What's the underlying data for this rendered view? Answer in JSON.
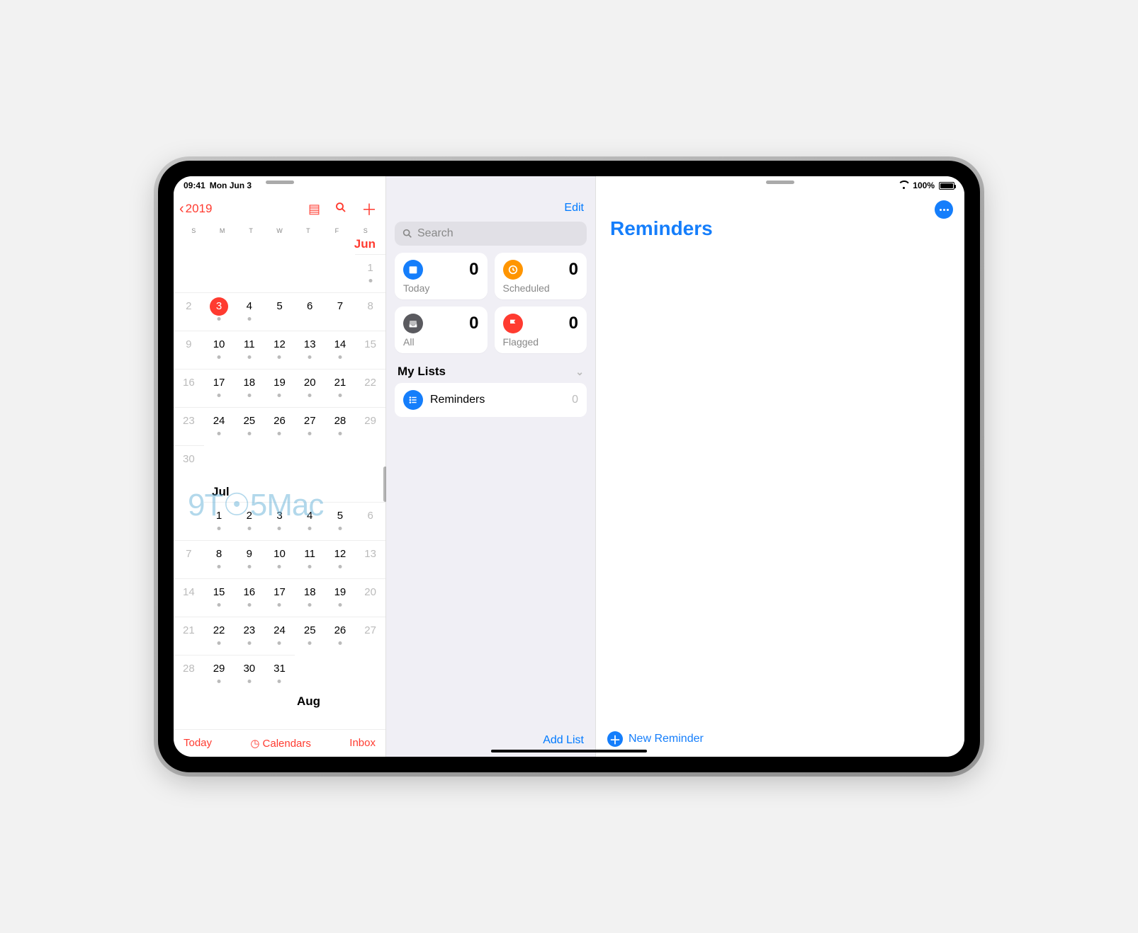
{
  "status": {
    "time": "09:41",
    "date": "Mon Jun 3",
    "battery_pct": "100%"
  },
  "calendar": {
    "back_label": "2019",
    "dow": [
      "S",
      "M",
      "T",
      "W",
      "T",
      "F",
      "S"
    ],
    "months": [
      {
        "name": "Jun",
        "red": true,
        "offset": 6,
        "days": [
          {
            "n": 1,
            "dot": true,
            "dim": true
          },
          {
            "n": 2,
            "dim": true
          },
          {
            "n": 3,
            "today": true,
            "dot": true
          },
          {
            "n": 4,
            "dot": true
          },
          {
            "n": 5
          },
          {
            "n": 6
          },
          {
            "n": 7
          },
          {
            "n": 8,
            "dim": true
          },
          {
            "n": 9,
            "dim": true
          },
          {
            "n": 10,
            "dot": true
          },
          {
            "n": 11,
            "dot": true
          },
          {
            "n": 12,
            "dot": true
          },
          {
            "n": 13,
            "dot": true
          },
          {
            "n": 14,
            "dot": true
          },
          {
            "n": 15,
            "dim": true
          },
          {
            "n": 16,
            "dim": true
          },
          {
            "n": 17,
            "dot": true
          },
          {
            "n": 18,
            "dot": true
          },
          {
            "n": 19,
            "dot": true
          },
          {
            "n": 20,
            "dot": true
          },
          {
            "n": 21,
            "dot": true
          },
          {
            "n": 22,
            "dim": true
          },
          {
            "n": 23,
            "dim": true
          },
          {
            "n": 24,
            "dot": true
          },
          {
            "n": 25,
            "dot": true
          },
          {
            "n": 26,
            "dot": true
          },
          {
            "n": 27,
            "dot": true
          },
          {
            "n": 28,
            "dot": true
          },
          {
            "n": 29,
            "dim": true
          },
          {
            "n": 30,
            "dim": true
          }
        ]
      },
      {
        "name": "Jul",
        "red": false,
        "offset": 1,
        "days": [
          {
            "n": 1,
            "dot": true
          },
          {
            "n": 2,
            "dot": true
          },
          {
            "n": 3,
            "dot": true
          },
          {
            "n": 4,
            "dot": true
          },
          {
            "n": 5,
            "dot": true
          },
          {
            "n": 6,
            "dim": true
          },
          {
            "n": 7,
            "dim": true
          },
          {
            "n": 8,
            "dot": true
          },
          {
            "n": 9,
            "dot": true
          },
          {
            "n": 10,
            "dot": true
          },
          {
            "n": 11,
            "dot": true
          },
          {
            "n": 12,
            "dot": true
          },
          {
            "n": 13,
            "dim": true
          },
          {
            "n": 14,
            "dim": true
          },
          {
            "n": 15,
            "dot": true
          },
          {
            "n": 16,
            "dot": true
          },
          {
            "n": 17,
            "dot": true
          },
          {
            "n": 18,
            "dot": true
          },
          {
            "n": 19,
            "dot": true
          },
          {
            "n": 20,
            "dim": true
          },
          {
            "n": 21,
            "dim": true
          },
          {
            "n": 22,
            "dot": true
          },
          {
            "n": 23,
            "dot": true
          },
          {
            "n": 24,
            "dot": true
          },
          {
            "n": 25,
            "dot": true
          },
          {
            "n": 26,
            "dot": true
          },
          {
            "n": 27,
            "dim": true
          },
          {
            "n": 28,
            "dim": true
          },
          {
            "n": 29,
            "dot": true
          },
          {
            "n": 30,
            "dot": true
          },
          {
            "n": 31,
            "dot": true
          }
        ]
      },
      {
        "name": "Aug",
        "red": false,
        "offset": 4,
        "days": []
      }
    ],
    "footer": {
      "today": "Today",
      "calendars": "Calendars",
      "inbox": "Inbox"
    },
    "watermark": "9T☉5Mac"
  },
  "reminders": {
    "edit": "Edit",
    "search_placeholder": "Search",
    "cards": {
      "today": {
        "label": "Today",
        "count": "0"
      },
      "scheduled": {
        "label": "Scheduled",
        "count": "0"
      },
      "all": {
        "label": "All",
        "count": "0"
      },
      "flagged": {
        "label": "Flagged",
        "count": "0"
      }
    },
    "my_lists_label": "My Lists",
    "lists": [
      {
        "name": "Reminders",
        "count": "0"
      }
    ],
    "add_list": "Add List",
    "main_title": "Reminders",
    "new_reminder": "New Reminder"
  }
}
